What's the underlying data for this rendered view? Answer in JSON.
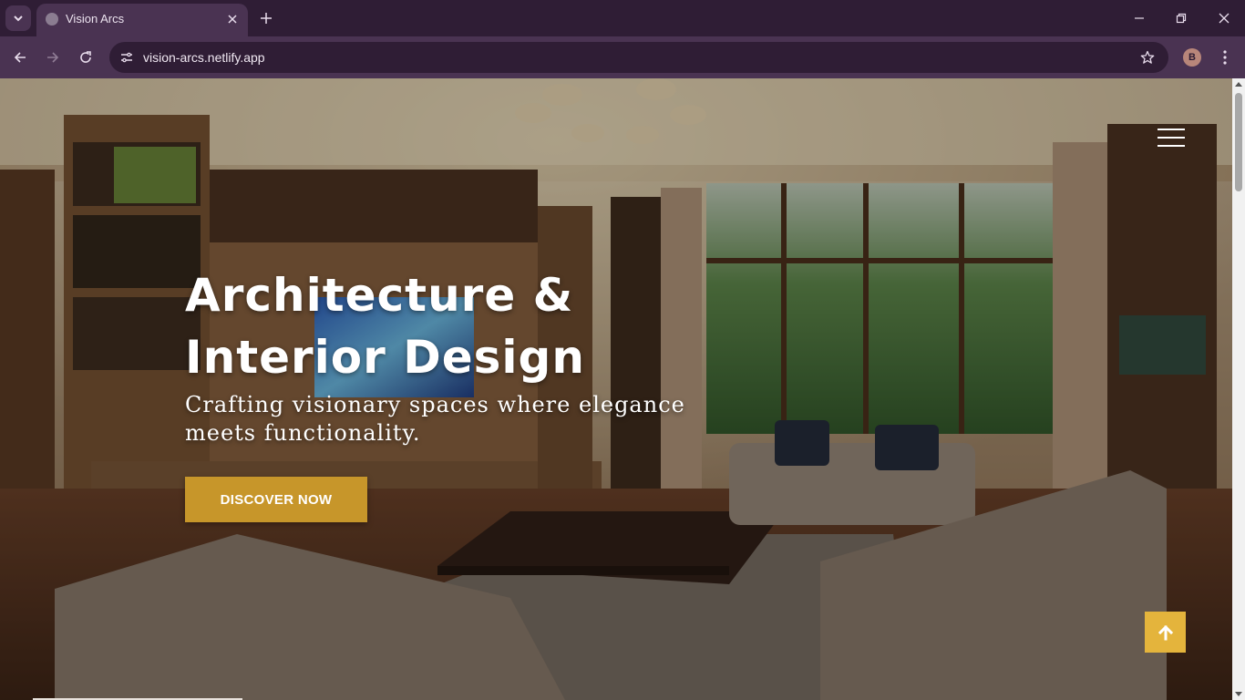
{
  "browser": {
    "tab_title": "Vision Arcs",
    "url": "vision-arcs.netlify.app",
    "profile_initial": "B",
    "icons": {
      "tab_search": "chevron-down-icon",
      "favicon": "globe-icon",
      "close_tab": "close-icon",
      "new_tab": "plus-icon",
      "minimize": "minimize-icon",
      "restore": "restore-icon",
      "close_window": "close-icon",
      "back": "arrow-left-icon",
      "forward": "arrow-right-icon",
      "reload": "reload-icon",
      "site_info": "tune-icon",
      "bookmark": "star-icon",
      "menu": "kebab-icon"
    },
    "colors": {
      "frame": "#2f1d35",
      "toolbar": "#4a3352"
    }
  },
  "hero": {
    "title_line1": "Architecture &",
    "title_line2": "Interior Design",
    "subtitle_line1": "Crafting visionary spaces where elegance",
    "subtitle_line2": "meets functionality.",
    "cta_label": "DISCOVER NOW",
    "background_image": "luxury living room interior",
    "menu_icon": "hamburger-icon",
    "back_to_top_icon": "arrow-up-icon",
    "colors": {
      "cta": "#c7962a",
      "back_to_top": "#e4b43c",
      "text": "#ffffff"
    }
  }
}
